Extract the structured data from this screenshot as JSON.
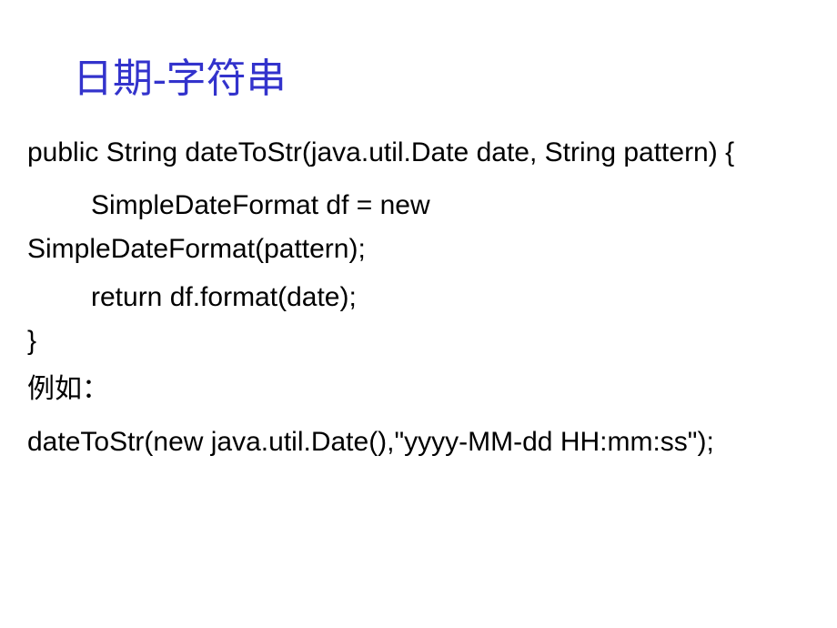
{
  "slide": {
    "title": "日期-字符串",
    "code": {
      "line1": "public String dateToStr(java.util.Date date, String pattern) {",
      "line2a": "SimpleDateFormat df = new",
      "line2b": "SimpleDateFormat(pattern);",
      "line3": "return df.format(date);",
      "line4": "}"
    },
    "example_label": "例如：",
    "example_code": "dateToStr(new java.util.Date(),\"yyyy-MM-dd HH:mm:ss\");"
  }
}
